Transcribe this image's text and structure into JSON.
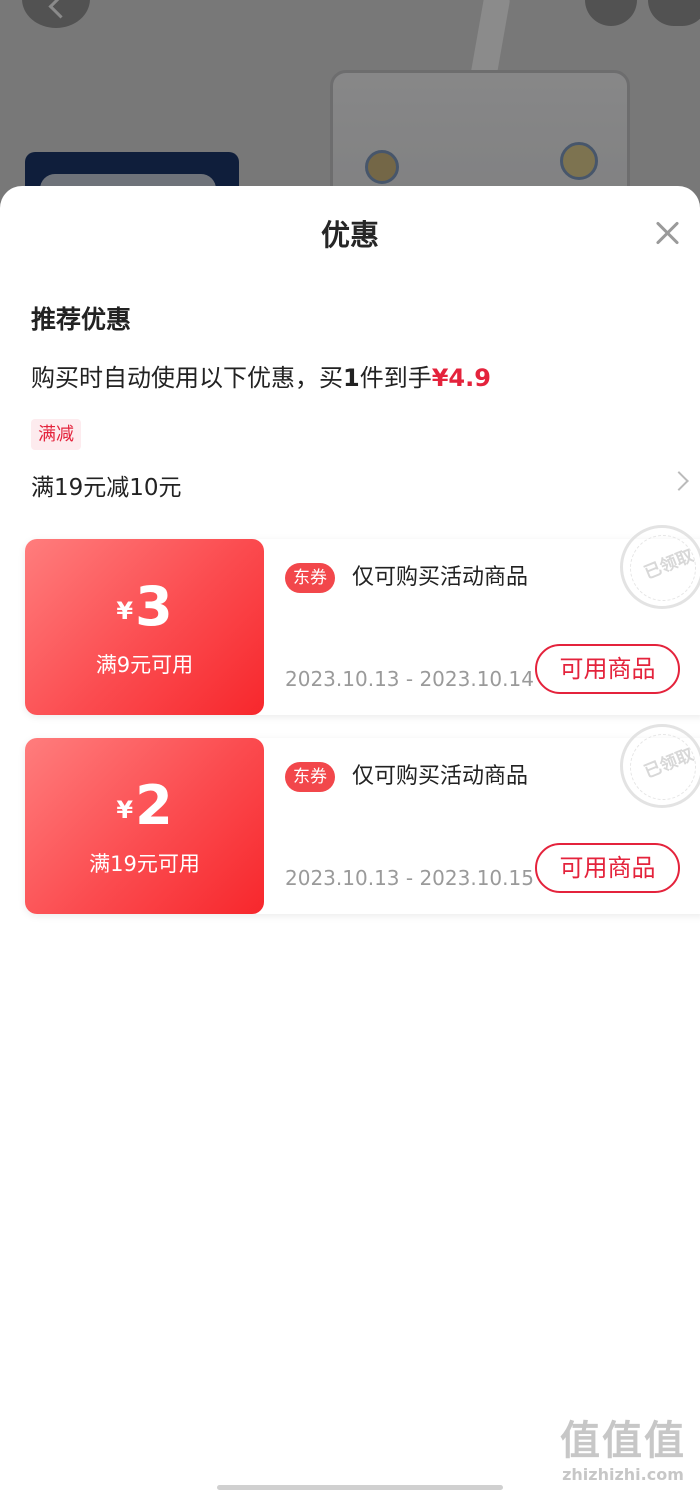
{
  "sheet": {
    "title": "优惠",
    "close_label": "关闭"
  },
  "recommend": {
    "section_title": "推荐优惠",
    "auto_prefix": "购买时自动使用以下优惠，买",
    "auto_qty": "1",
    "auto_suffix": "件到手",
    "auto_price": "¥4.9"
  },
  "promotion": {
    "tag": "满减",
    "rule": "满19元减10元"
  },
  "coupons": [
    {
      "currency": "¥",
      "amount": "3",
      "threshold": "满9元可用",
      "badge": "东券",
      "description": "仅可购买活动商品",
      "dates": "2023.10.13 - 2023.10.14",
      "button": "可用商品",
      "stamp": "已领取"
    },
    {
      "currency": "¥",
      "amount": "2",
      "threshold": "满19元可用",
      "badge": "东券",
      "description": "仅可购买活动商品",
      "dates": "2023.10.13 - 2023.10.15",
      "button": "可用商品",
      "stamp": "已领取"
    }
  ],
  "watermark": {
    "logo": "值值值",
    "url": "zhizhizhi.com"
  },
  "colors": {
    "accent_red": "#e4233c",
    "coupon_gradient_start": "#ff7d7d",
    "coupon_gradient_end": "#f7272c",
    "muted_text": "#9a9a9a"
  },
  "icons": {
    "close": "close-icon",
    "chevron": "chevron-right-icon",
    "back": "back-arrow-icon",
    "share": "share-icon",
    "cart": "cart-icon"
  }
}
